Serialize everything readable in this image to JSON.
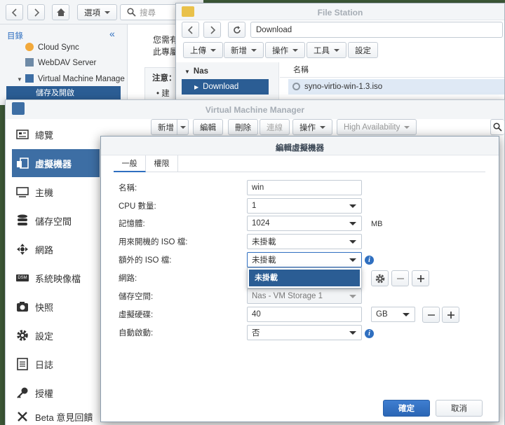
{
  "control_panel": {
    "options_label": "選項",
    "search_placeholder": "搜尋",
    "sidebar_title": "目錄",
    "tree": [
      "Cloud Sync",
      "WebDAV Server",
      "Virtual Machine Manage",
      "儲存及開啟"
    ],
    "content_lines": [
      "您需有",
      "此專屬"
    ],
    "note_label": "注意：",
    "note_bullet": "建"
  },
  "file_station": {
    "title": "File Station",
    "path": "Download",
    "toolbar": [
      "上傳",
      "新增",
      "操作",
      "工具",
      "設定"
    ],
    "tree_root": "Nas",
    "tree_selected": "Download",
    "col_name": "名稱",
    "file": "syno-virtio-win-1.3.iso"
  },
  "vmm": {
    "title": "Virtual Machine Manager",
    "toolbar": {
      "new": "新增",
      "edit": "編輯",
      "delete": "刪除",
      "connect": "連線",
      "action": "操作",
      "ha": "High Availability"
    },
    "nav": [
      {
        "label": "總覽",
        "icon": "overview-icon"
      },
      {
        "label": "虛擬機器",
        "icon": "virtual-machine-icon"
      },
      {
        "label": "主機",
        "icon": "host-icon"
      },
      {
        "label": "儲存空間",
        "icon": "storage-icon"
      },
      {
        "label": "網路",
        "icon": "network-icon"
      },
      {
        "label": "系統映像檔",
        "icon": "dsm-image-icon"
      },
      {
        "label": "快照",
        "icon": "snapshot-icon"
      },
      {
        "label": "設定",
        "icon": "gear-icon"
      },
      {
        "label": "日誌",
        "icon": "log-icon"
      },
      {
        "label": "授權",
        "icon": "key-icon"
      },
      {
        "label": "Beta 意見回饋",
        "icon": "tools-icon"
      }
    ]
  },
  "dialog": {
    "title": "編輯虛擬機器",
    "tabs": [
      "一般",
      "權限"
    ],
    "fields": {
      "name": {
        "label": "名稱:",
        "value": "win"
      },
      "cpu": {
        "label": "CPU 數量:",
        "value": "1"
      },
      "memory": {
        "label": "記憶體:",
        "value": "1024",
        "unit": "MB"
      },
      "boot_iso": {
        "label": "用來開機的 ISO 檔:",
        "value": "未掛載"
      },
      "extra_iso": {
        "label": "額外的 ISO 檔:",
        "value": "未掛載"
      },
      "network": {
        "label": "網路:"
      },
      "storage": {
        "label": "儲存空間:",
        "value": "Nas - VM Storage 1"
      },
      "disk": {
        "label": "虛擬硬碟:",
        "value": "40",
        "unit": "GB"
      },
      "autostart": {
        "label": "自動啟動:",
        "value": "否"
      }
    },
    "dropdown_options": [
      "未掛載"
    ],
    "ok_label": "確定",
    "cancel_label": "取消"
  }
}
